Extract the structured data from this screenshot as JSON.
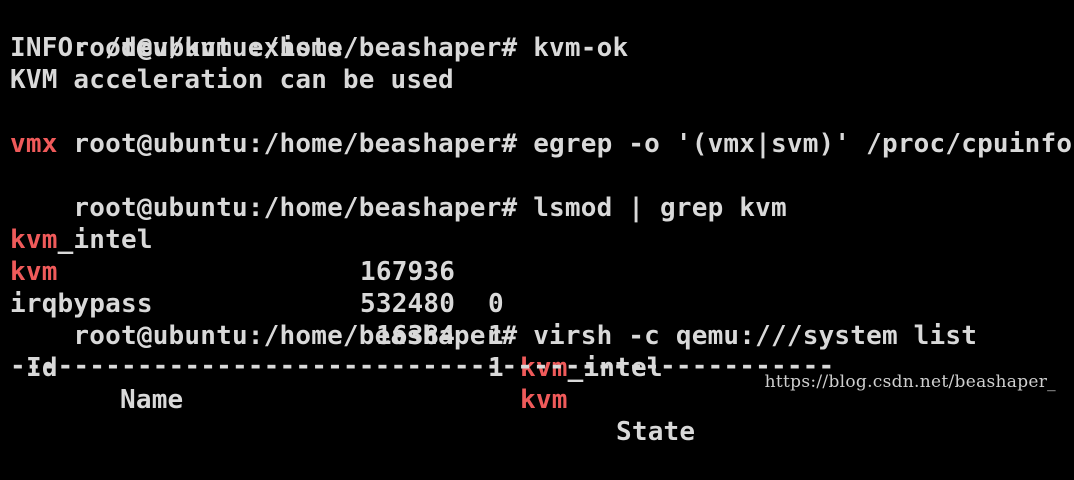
{
  "terminal": {
    "colors": {
      "background": "#000000",
      "text": "#d9d9d9",
      "highlight": "#ef5a5a"
    },
    "lines": [
      {
        "prompt": "root@ubuntu:/home/beashaper#",
        "command": "kvm-ok"
      },
      {
        "text": "INFO: /dev/kvm exists"
      },
      {
        "text": "KVM acceleration can be used"
      },
      {
        "prompt": "root@ubuntu:/home/beashaper#",
        "command": "egrep -o '(vmx|svm)' /proc/cpuinfo"
      },
      {
        "highlight": "vmx"
      },
      {
        "prompt": "root@ubuntu:/home/beashaper#",
        "command": "lsmod | grep kvm"
      },
      {
        "module_a": "kvm",
        "module_b": "_intel",
        "size": "167936",
        "used": "0",
        "by": ""
      },
      {
        "module_a": "kvm",
        "module_b": "",
        "size": "532480",
        "used": "1",
        "by_a": "kvm",
        "by_b": "_intel"
      },
      {
        "module_plain": "irqbypass",
        "size": "16384",
        "used": "1",
        "by_a": "kvm"
      },
      {
        "prompt": "root@ubuntu:/home/beashaper#",
        "command": "virsh -c qemu:///system list"
      },
      {
        "col_id": "Id",
        "col_name": "Name",
        "col_state": "State"
      },
      {
        "separator": "----------------------------------------------------"
      }
    ]
  },
  "watermark": {
    "text": "https://blog.csdn.net/beashaper_"
  }
}
